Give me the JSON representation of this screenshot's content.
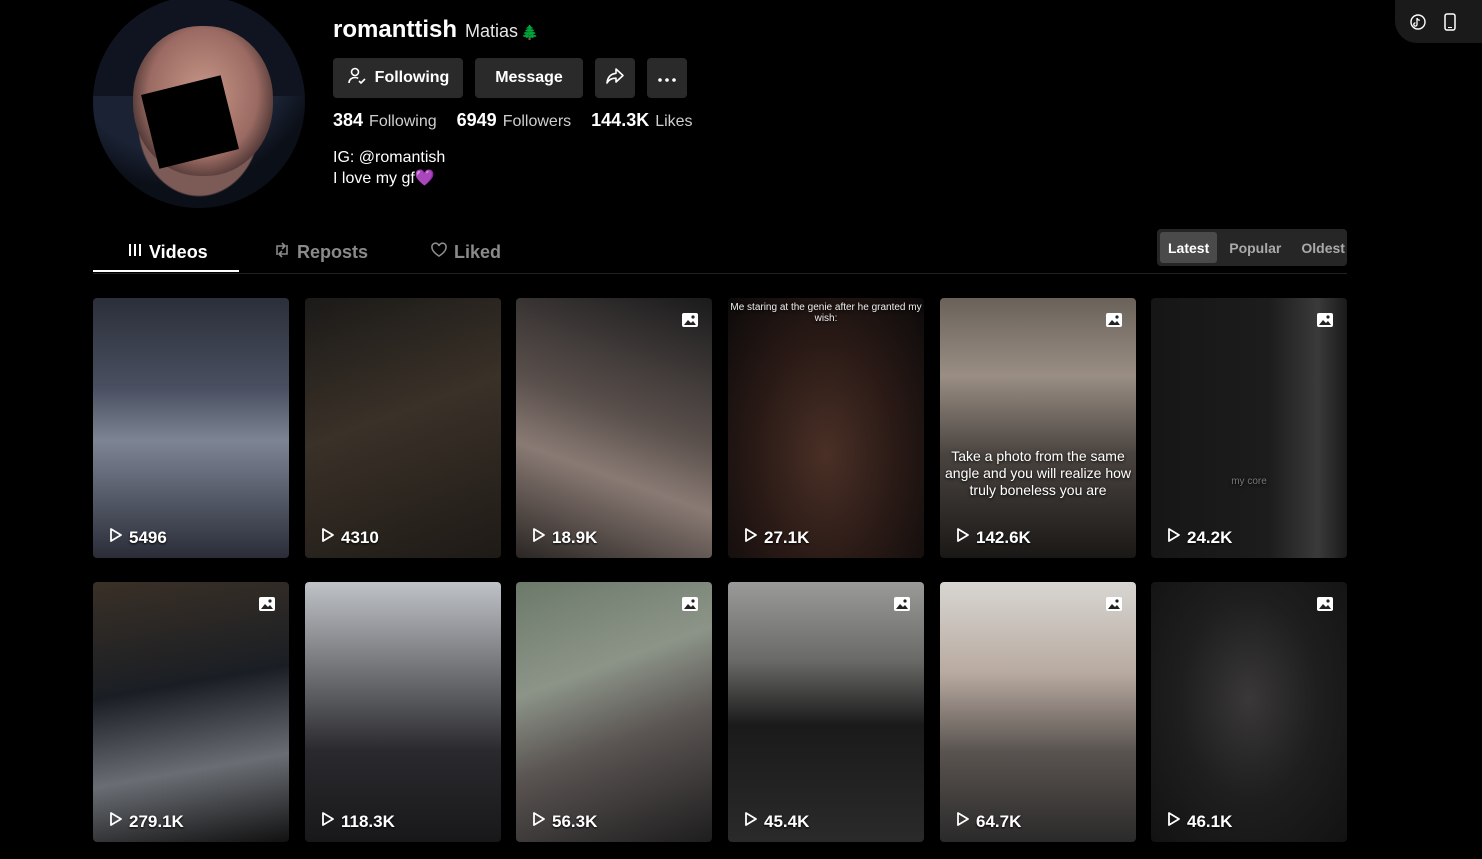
{
  "profile": {
    "username": "romanttish",
    "nickname": "Matias",
    "nickname_emoji": "🌲",
    "buttons": {
      "following_label": "Following",
      "message_label": "Message"
    },
    "stats": {
      "following_count": "384",
      "following_label": "Following",
      "followers_count": "6949",
      "followers_label": "Followers",
      "likes_count": "144.3K",
      "likes_label": "Likes"
    },
    "bio_line1": "IG: @romantish",
    "bio_line2": "I love my gf",
    "bio_emoji": "💜"
  },
  "tabs": {
    "videos": "Videos",
    "reposts": "Reposts",
    "liked": "Liked"
  },
  "sort": {
    "latest": "Latest",
    "popular": "Popular",
    "oldest": "Oldest"
  },
  "videos": [
    {
      "views": "5496",
      "bg": "linear-gradient(180deg,#2b2f3a 0%,#4a5061 35%,#7d8494 55%,#2a2d38 100%)"
    },
    {
      "views": "4310",
      "bg": "linear-gradient(160deg,#1b1a18 0%,#3a3128 45%,#1e1a16 100%)"
    },
    {
      "views": "18.9K",
      "bg": "linear-gradient(200deg,#1a1a1c 0%,#5a504c 45%,#8a7a74 65%,#2a2624 100%)",
      "image": true
    },
    {
      "views": "27.1K",
      "bg": "radial-gradient(ellipse at 50% 60%,#4a3026 0%,#2a1a16 50%,#0c0a0a 100%)",
      "caption": "Me staring at the genie after he granted my wish:"
    },
    {
      "views": "142.6K",
      "bg": "linear-gradient(180deg,#6a625a 0%,#9a8e84 30%,#4a4440 60%,#1a1816 100%)",
      "image": true,
      "caption": "Take a photo from the same angle and you will realize how truly boneless you are"
    },
    {
      "views": "24.2K",
      "bg": "linear-gradient(90deg,#161616 0%,#1c1c1c 60%,#3a3a3a 85%,#1a1a1a 100%)",
      "image": true,
      "caption": "my core"
    },
    {
      "views": "279.1K",
      "bg": "linear-gradient(170deg,#3a3026 0%,#1a1e24 40%,#6a6e74 70%,#111 100%)",
      "image": true
    },
    {
      "views": "118.3K",
      "bg": "linear-gradient(180deg,#bfc2c6 0%,#7a7c80 30%,#2a2a2e 65%,#18181a 100%)"
    },
    {
      "views": "56.3K",
      "bg": "linear-gradient(160deg,#6c7a6a 0%,#8c9488 35%,#5a5452 60%,#1e1e1e 100%)",
      "image": true
    },
    {
      "views": "45.4K",
      "bg": "linear-gradient(180deg,#9a9a98 0%,#6a6a68 30%,#1a1a1a 55%,#2a2a2a 100%)",
      "image": true
    },
    {
      "views": "64.7K",
      "bg": "linear-gradient(180deg,#d8d6d2 0%,#b8aaa0 35%,#5a5450 65%,#2a2a2a 100%)",
      "image": true
    },
    {
      "views": "46.1K",
      "bg": "radial-gradient(ellipse at 50% 45%,#3a3838 0%,#1e1e1e 50%,#121212 100%)",
      "image": true
    }
  ]
}
